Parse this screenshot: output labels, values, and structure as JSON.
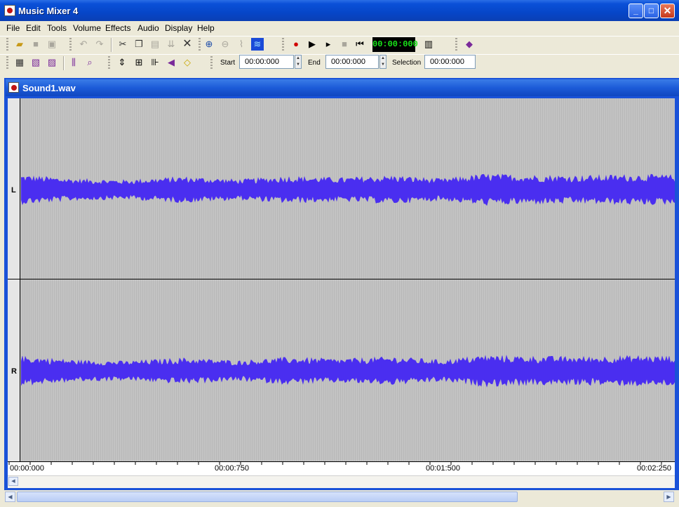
{
  "window": {
    "title": "Music Mixer 4",
    "minimize": "_",
    "maximize": "□",
    "close": "✕"
  },
  "menu": [
    "File",
    "Edit",
    "Tools",
    "Volume",
    "Effects",
    "Audio",
    "Display",
    "Help"
  ],
  "transport": {
    "start_label": "Start",
    "start_value": "00:00:000",
    "end_label": "End",
    "end_value": "00:00:000",
    "selection_label": "Selection",
    "selection_value": "00:00:000",
    "counter": "00:00:000"
  },
  "document": {
    "title": "Sound1.wav",
    "channels": [
      "L",
      "R"
    ],
    "timeline": [
      "00:00:000",
      "00:00:750",
      "00:01:500",
      "00:02:250"
    ],
    "waveform_color": "#4a2ef0"
  },
  "icons": {
    "toolbar1": [
      "open-folder-icon",
      "stop-square-icon",
      "save-icon",
      "undo-icon",
      "redo-icon",
      "cut-icon",
      "copy-icon",
      "paste-icon",
      "mix-paste-icon",
      "delete-icon",
      "zoom-in-icon",
      "zoom-out-icon",
      "zoom-fit-icon",
      "zoom-selection-icon",
      "record-icon",
      "play-icon",
      "play-selection-icon",
      "stop-icon",
      "rewind-icon",
      "level-meter-icon",
      "help-book-icon"
    ],
    "toolbar2": [
      "insert-silence-icon",
      "mix-file-icon",
      "append-file-icon",
      "trim-icon",
      "zoom-region-icon",
      "normalize-icon",
      "amplify-icon",
      "equalizer-icon",
      "reverse-icon",
      "eraser-icon"
    ]
  }
}
